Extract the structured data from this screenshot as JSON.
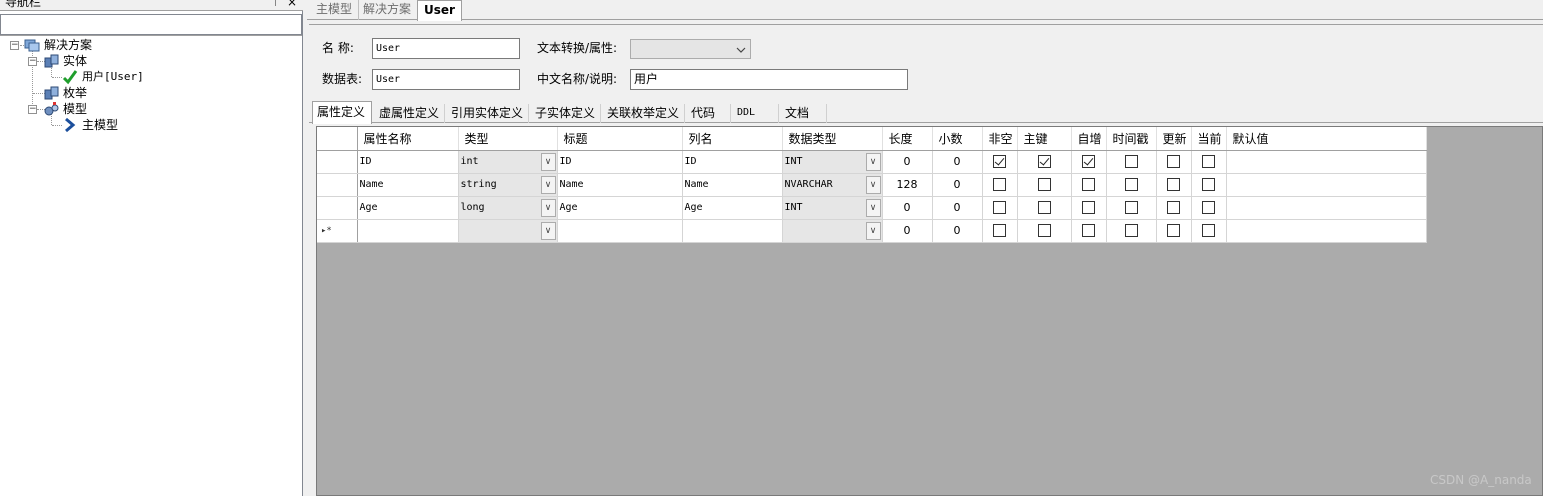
{
  "nav": {
    "title": "导航栏",
    "pin": "ᛘ",
    "close": "×",
    "tree": {
      "root": "解决方案",
      "entities": "实体",
      "entity_user": "用户[User]",
      "enums": "枚举",
      "models": "模型",
      "model_main": "主模型"
    }
  },
  "doc_tabs": [
    "主模型",
    "解决方案",
    "User"
  ],
  "form": {
    "name_label": "名  称:",
    "name_value": "User",
    "text_convert_label": "文本转换/属性:",
    "text_convert_value": "",
    "table_label": "数据表:",
    "table_value": "User",
    "cn_name_label": "中文名称/说明:",
    "cn_name_value": "用户"
  },
  "sub_tabs": [
    "属性定义",
    "虚属性定义",
    "引用实体定义",
    "子实体定义",
    "关联枚举定义",
    "代码",
    "DDL",
    "文档"
  ],
  "grid": {
    "headers": [
      "属性名称",
      "类型",
      "标题",
      "列名",
      "数据类型",
      "长度",
      "小数",
      "非空",
      "主键",
      "自增",
      "时间戳",
      "更新",
      "当前",
      "默认值"
    ],
    "rows": [
      {
        "name": "ID",
        "type": "int",
        "title": "ID",
        "column": "ID",
        "dtype": "INT",
        "length": "0",
        "decimal": "0",
        "notnull": true,
        "pk": true,
        "auto": true,
        "ts": false,
        "update": false,
        "current": false
      },
      {
        "name": "Name",
        "type": "string",
        "title": "Name",
        "column": "Name",
        "dtype": "NVARCHAR",
        "length": "128",
        "decimal": "0",
        "notnull": false,
        "pk": false,
        "auto": false,
        "ts": false,
        "update": false,
        "current": false
      },
      {
        "name": "Age",
        "type": "long",
        "title": "Age",
        "column": "Age",
        "dtype": "INT",
        "length": "0",
        "decimal": "0",
        "notnull": false,
        "pk": false,
        "auto": false,
        "ts": false,
        "update": false,
        "current": false
      }
    ],
    "new_row": {
      "marker": "▸*",
      "length": "0",
      "decimal": "0"
    },
    "dropdown_glyph": "∨"
  },
  "watermark": "CSDN @A_nanda"
}
